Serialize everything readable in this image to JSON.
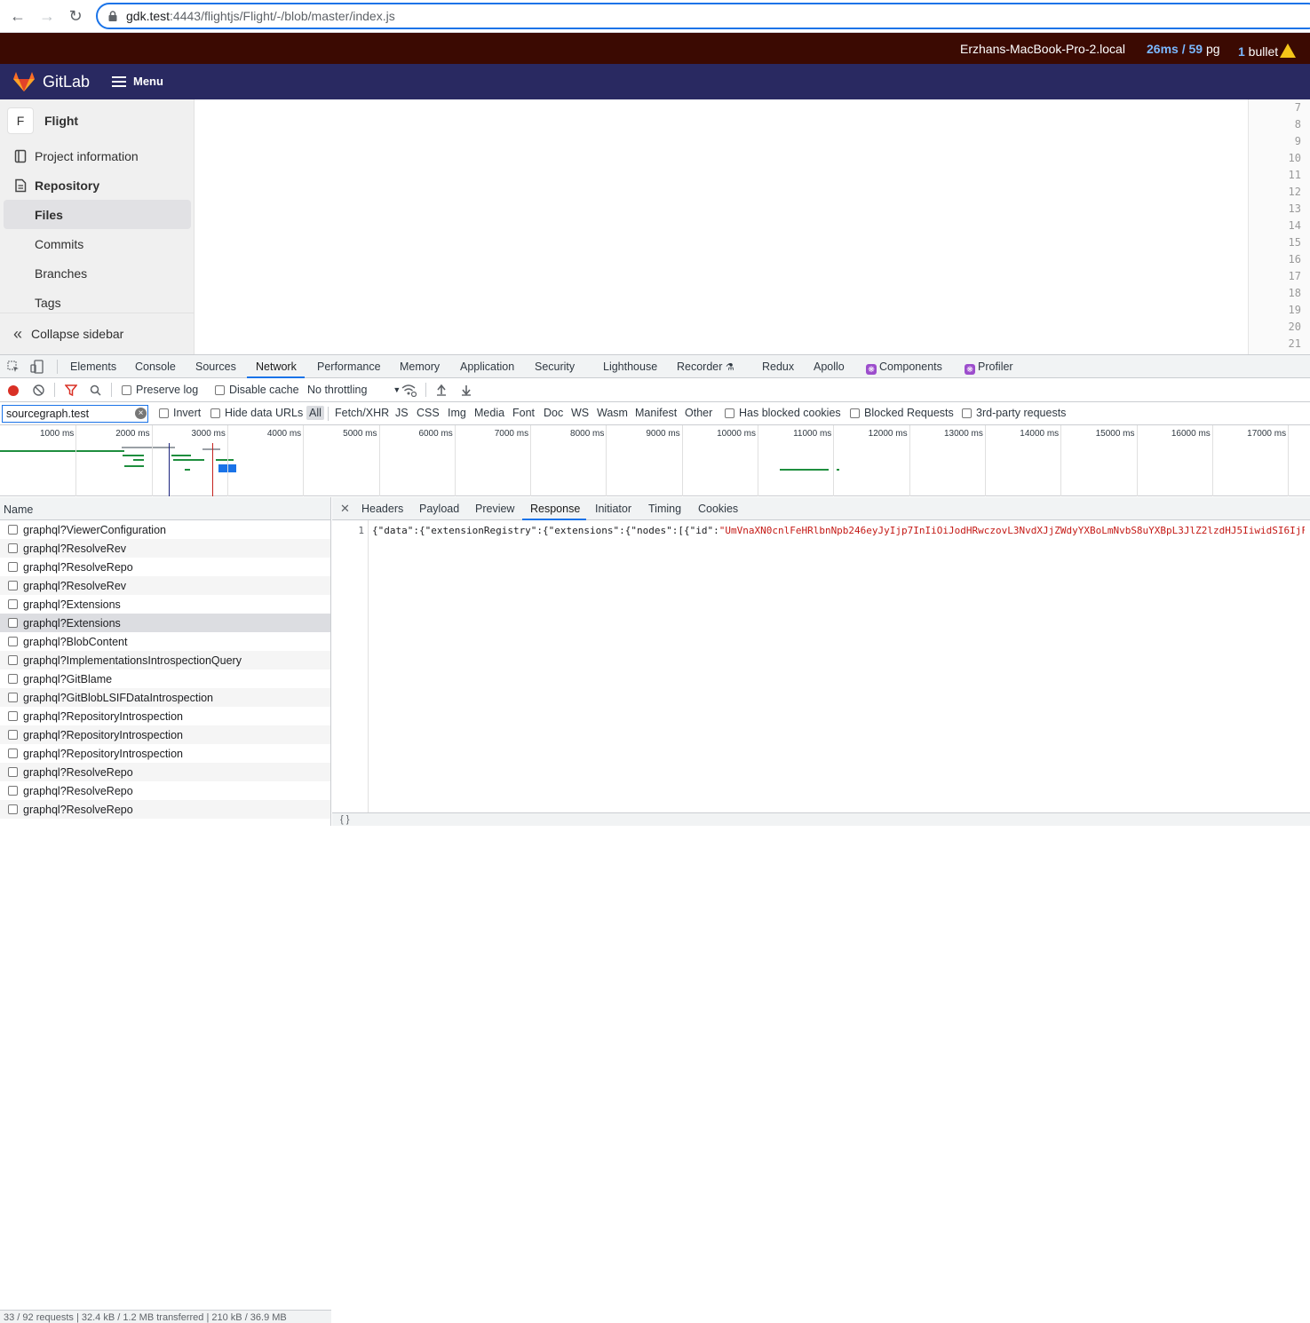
{
  "browser": {
    "url_host": "gdk.test",
    "url_rest": ":4443/flightjs/Flight/-/blob/master/index.js"
  },
  "perf_bar": {
    "host": "Erzhans-MacBook-Pro-2.local",
    "timing_ms": "26ms",
    "timing_sep": " / ",
    "queries": "59",
    "queries_label": " pg",
    "bullet_count": "1",
    "bullet_label": " bullet"
  },
  "gitlab": {
    "brand": "GitLab",
    "menu_label": "Menu"
  },
  "sidebar": {
    "project_initial": "F",
    "project_name": "Flight",
    "items": [
      {
        "label": "Project information"
      },
      {
        "label": "Repository"
      },
      {
        "label": "Files"
      },
      {
        "label": "Commits"
      },
      {
        "label": "Branches"
      },
      {
        "label": "Tags"
      }
    ],
    "collapse_label": "Collapse sidebar"
  },
  "line_numbers": [
    "7",
    "8",
    "9",
    "10",
    "11",
    "12",
    "13",
    "14",
    "15",
    "16",
    "17",
    "18",
    "19",
    "20",
    "21"
  ],
  "devtools": {
    "tabs": [
      "Elements",
      "Console",
      "Sources",
      "Network",
      "Performance",
      "Memory",
      "Application",
      "Security",
      "Lighthouse",
      "Recorder",
      "Redux",
      "Apollo",
      "Components",
      "Profiler"
    ],
    "active_tab": "Network",
    "toolbar": {
      "preserve_log": "Preserve log",
      "disable_cache": "Disable cache",
      "throttling": "No throttling"
    },
    "filter": {
      "value": "sourcegraph.test",
      "invert": "Invert",
      "hide_data_urls": "Hide data URLs",
      "types": [
        "All",
        "Fetch/XHR",
        "JS",
        "CSS",
        "Img",
        "Media",
        "Font",
        "Doc",
        "WS",
        "Wasm",
        "Manifest",
        "Other"
      ],
      "has_blocked_cookies": "Has blocked cookies",
      "blocked_requests": "Blocked Requests",
      "third_party": "3rd-party requests"
    },
    "overview_ticks": [
      "1000 ms",
      "2000 ms",
      "3000 ms",
      "4000 ms",
      "5000 ms",
      "6000 ms",
      "7000 ms",
      "8000 ms",
      "9000 ms",
      "10000 ms",
      "11000 ms",
      "12000 ms",
      "13000 ms",
      "14000 ms",
      "15000 ms",
      "16000 ms",
      "17000 ms"
    ],
    "requests_header": "Name",
    "requests": [
      "graphql?ViewerConfiguration",
      "graphql?ResolveRev",
      "graphql?ResolveRepo",
      "graphql?ResolveRev",
      "graphql?Extensions",
      "graphql?Extensions",
      "graphql?BlobContent",
      "graphql?ImplementationsIntrospectionQuery",
      "graphql?GitBlame",
      "graphql?GitBlobLSIFDataIntrospection",
      "graphql?RepositoryIntrospection",
      "graphql?RepositoryIntrospection",
      "graphql?RepositoryIntrospection",
      "graphql?ResolveRepo",
      "graphql?ResolveRepo",
      "graphql?ResolveRepo"
    ],
    "selected_request_index": 5,
    "status_text": "33 / 92 requests  |  32.4 kB / 1.2 MB transferred  |  210 kB / 36.9 MB",
    "detail_tabs": [
      "Headers",
      "Payload",
      "Preview",
      "Response",
      "Initiator",
      "Timing",
      "Cookies"
    ],
    "active_detail_tab": "Response",
    "response": {
      "line_no": "1",
      "code_prefix": "{\"data\":{\"extensionRegistry\":{\"extensions\":{\"nodes\":[{\"id\":",
      "code_string": "\"UmVnaXN0cnlFeHRlbnNpb246eyJyIjp7InIiOiJodHRwczovL3NvdXJjZWdyYXBoLmNvbS8uYXBpL3JlZ2lzdHJ5IiwidSI6IjF:"
    },
    "format_label": "{ }"
  }
}
